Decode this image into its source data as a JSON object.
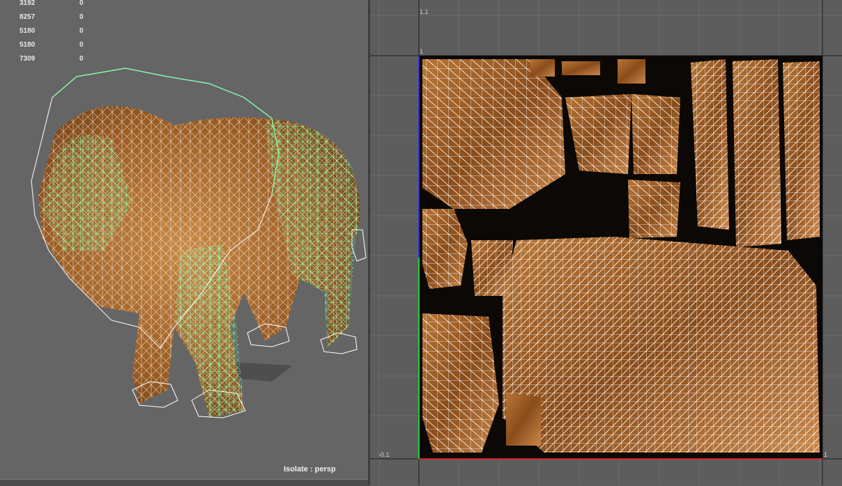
{
  "viewport": {
    "hud_rows": [
      {
        "label": "3192",
        "value": "0"
      },
      {
        "label": "8257",
        "value": "0"
      },
      {
        "label": "5180",
        "value": "0"
      },
      {
        "label": "5180",
        "value": "0"
      },
      {
        "label": "7309",
        "value": "0"
      }
    ],
    "isolate_label": "Isolate : persp"
  },
  "uv_editor": {
    "tick_top_left": "1.1",
    "tick_one_top": "1",
    "tick_bottom_left": "-0.1",
    "tick_bottom_right": "1"
  },
  "colors": {
    "viewport_bg": "#656565",
    "uv_bg": "#5d5d5d",
    "selection_green": "#7dffaa",
    "wire_white": "#ffffff",
    "fur_brown": "#a8662a",
    "uv_axis_red": "#ff2020",
    "uv_axis_blue": "#3030ff"
  }
}
